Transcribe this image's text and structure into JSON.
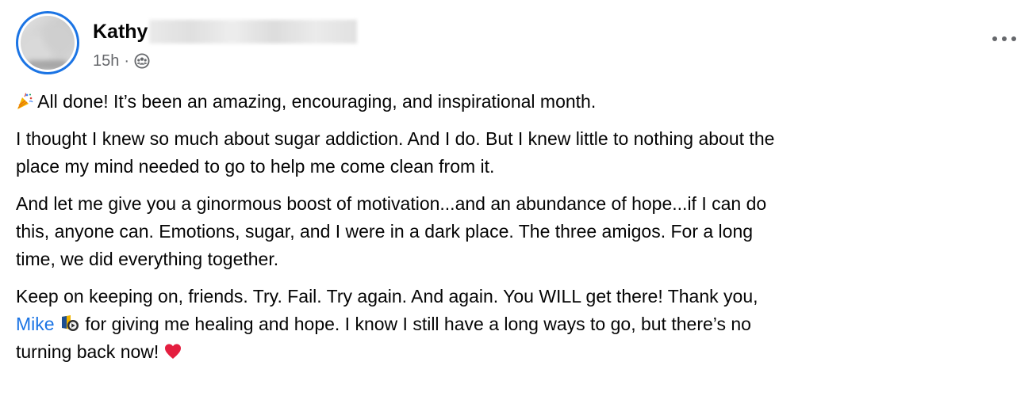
{
  "post": {
    "author": {
      "name": "Kathy",
      "avatar_icon": "profile-photo"
    },
    "meta": {
      "timestamp": "15h",
      "separator": "·",
      "audience_icon": "group-members-icon"
    },
    "more_icon": "more-options-icon",
    "body": {
      "p1_line1": "All done! It’s been an amazing, encouraging, and inspirational month.",
      "p1_emoji": "party-popper-emoji",
      "p2_line1": "I thought I knew so much about sugar addiction. And I do. But I knew little to nothing about the",
      "p2_line2": "place my mind needed to go to help me come clean from it.",
      "p3_line1": "And let me give you a ginormous boost of motivation...and an abundance of hope...if I can do",
      "p3_line2": "this, anyone can. Emotions, sugar, and I were in a dark place. The three amigos. For a long",
      "p3_line3": "time, we did everything together.",
      "p4_line1": "Keep on keeping on, friends. Try. Fail. Try again. And again. You WILL get there! Thank you,",
      "p4_mention": "Mike",
      "p4_mention_badge": "top-contributor-badge",
      "p4_line2_rest": "for giving me healing and hope. I know I still have a long ways to go, but there’s no",
      "p4_line3": "turning back now!",
      "p4_emoji": "red-heart-emoji"
    },
    "colors": {
      "accent": "#1b74e4",
      "text": "#050505",
      "secondary_text": "#65676b",
      "heart": "#e41e3f"
    }
  }
}
